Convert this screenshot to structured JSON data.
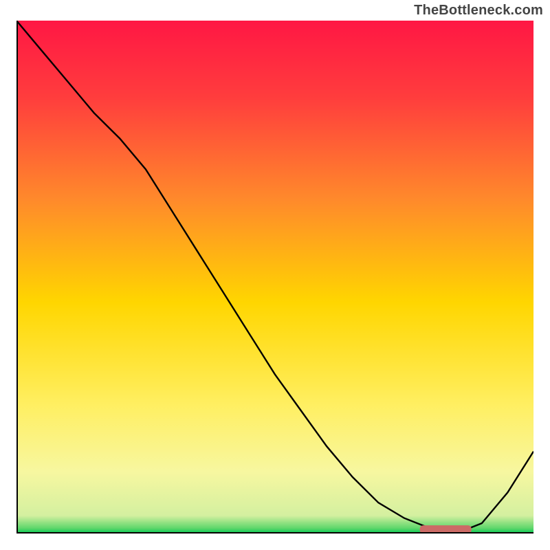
{
  "watermark": "TheBottleneck.com",
  "chart_data": {
    "type": "line",
    "title": "",
    "xlabel": "",
    "ylabel": "",
    "xlim": [
      0,
      100
    ],
    "ylim": [
      0,
      100
    ],
    "grid": false,
    "legend": false,
    "background_gradient_stops": [
      {
        "offset": 0.0,
        "color": "#ff1744"
      },
      {
        "offset": 0.15,
        "color": "#ff3d3d"
      },
      {
        "offset": 0.35,
        "color": "#ff8a2b"
      },
      {
        "offset": 0.55,
        "color": "#ffd600"
      },
      {
        "offset": 0.75,
        "color": "#ffef62"
      },
      {
        "offset": 0.88,
        "color": "#f7f7a0"
      },
      {
        "offset": 0.965,
        "color": "#d4f0a0"
      },
      {
        "offset": 0.99,
        "color": "#5dd66a"
      },
      {
        "offset": 1.0,
        "color": "#00c853"
      }
    ],
    "series": [
      {
        "name": "curve",
        "stroke": "#000000",
        "stroke_width": 2.4,
        "x": [
          0,
          5,
          10,
          15,
          20,
          25,
          30,
          35,
          40,
          45,
          50,
          55,
          60,
          65,
          70,
          75,
          80,
          85,
          90,
          95,
          100
        ],
        "y": [
          100,
          94,
          88,
          82,
          77,
          71,
          63,
          55,
          47,
          39,
          31,
          24,
          17,
          11,
          6,
          3,
          1,
          0,
          2,
          8,
          16
        ]
      }
    ],
    "marker_bar": {
      "name": "optimal-range-marker",
      "color": "#cc6b66",
      "x0": 78,
      "x1": 88,
      "y": 0.8,
      "height": 1.6
    },
    "axes": {
      "left": {
        "x": 0,
        "y0": 0,
        "y1": 100,
        "color": "#000",
        "width": 4
      },
      "bottom": {
        "y": 0,
        "x0": 0,
        "x1": 100,
        "color": "#000",
        "width": 4
      }
    }
  }
}
